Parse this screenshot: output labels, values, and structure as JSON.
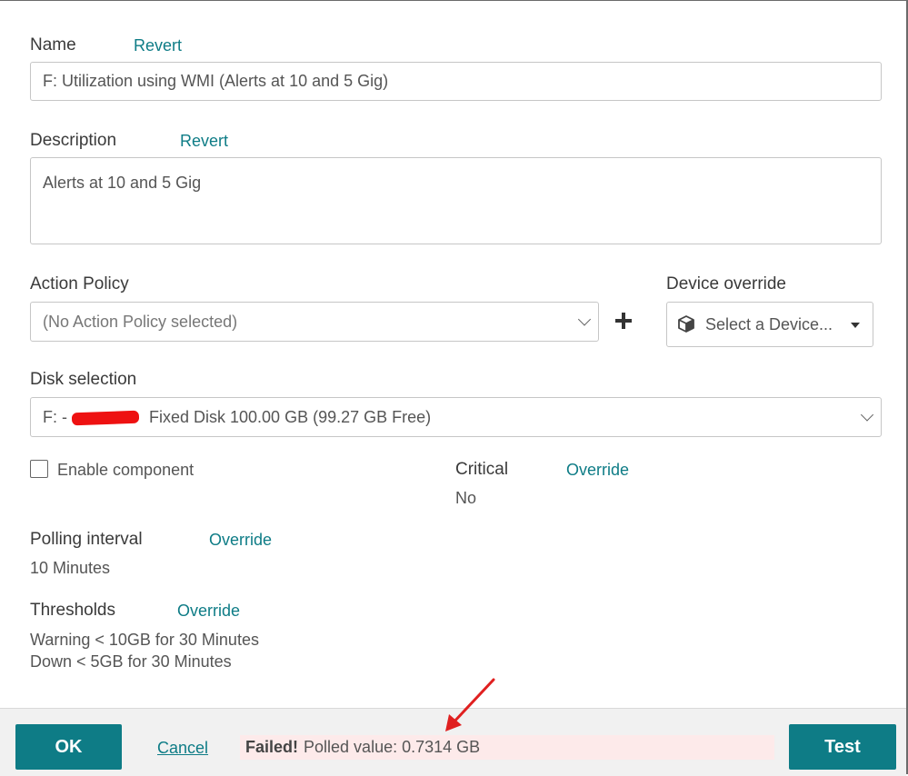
{
  "form": {
    "name": {
      "label": "Name",
      "revert": "Revert",
      "value": "F: Utilization using WMI (Alerts at 10 and 5 Gig)"
    },
    "description": {
      "label": "Description",
      "revert": "Revert",
      "value": "Alerts at 10 and 5 Gig"
    },
    "action_policy": {
      "label": "Action Policy",
      "placeholder": "(No Action Policy selected)"
    },
    "device_override": {
      "label": "Device override",
      "placeholder": "Select a Device..."
    },
    "disk_selection": {
      "label": "Disk selection",
      "value_prefix": "F: - ",
      "value_suffix": "Fixed Disk 100.00 GB (99.27 GB Free)"
    },
    "enable_component": {
      "label": "Enable component",
      "checked": false
    },
    "critical": {
      "label": "Critical",
      "override": "Override",
      "value": "No"
    },
    "polling_interval": {
      "label": "Polling interval",
      "override": "Override",
      "value": "10 Minutes"
    },
    "thresholds": {
      "label": "Thresholds",
      "override": "Override",
      "warning": "Warning < 10GB for 30 Minutes",
      "down": "Down < 5GB for 30 Minutes"
    }
  },
  "footer": {
    "ok_label": "OK",
    "cancel_label": "Cancel",
    "status_strong": "Failed!",
    "status_text": "Polled value: 0.7314 GB",
    "test_label": "Test"
  },
  "colors": {
    "accent": "#0e7c86",
    "status_bg": "#fdeaea",
    "annotation_arrow": "#e02020"
  },
  "icons": {
    "device": "cube-icon",
    "add": "plus-icon",
    "dropdown": "chevron-down-icon",
    "caret": "caret-down-icon"
  }
}
